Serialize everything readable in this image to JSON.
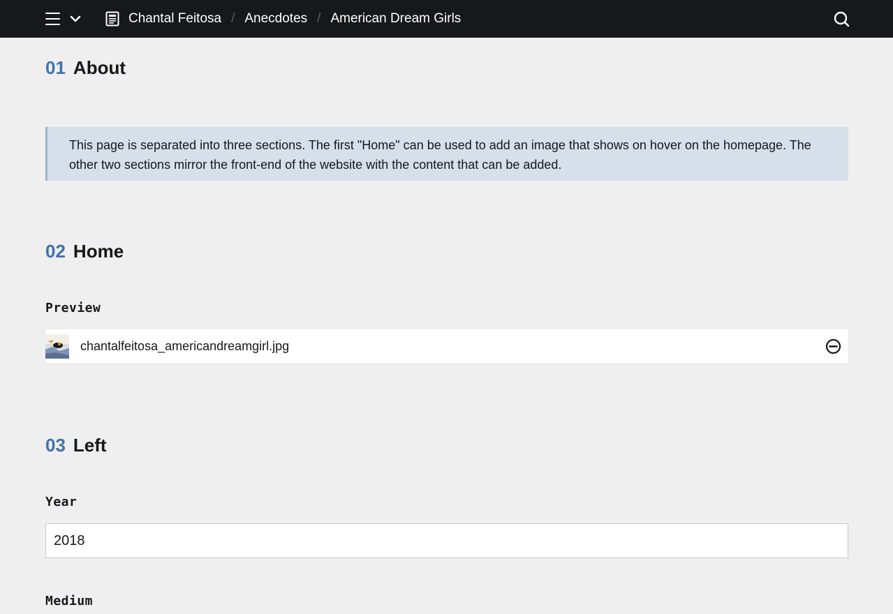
{
  "header": {
    "breadcrumb": [
      {
        "label": "Chantal Feitosa"
      },
      {
        "label": "Anecdotes"
      },
      {
        "label": "American Dream Girls"
      }
    ],
    "separator": "/",
    "icons": {
      "menu": "hamburger-menu-icon",
      "dropdown": "chevron-down-icon",
      "page": "page-document-icon",
      "search": "search-icon"
    }
  },
  "sections": {
    "about": {
      "number": "01",
      "title": "About",
      "info": "This page is separated into three sections. The first \"Home\" can be used to add an image that shows on hover on the homepage. The other two sections mirror the front-end of the website with the content that can be added."
    },
    "home": {
      "number": "02",
      "title": "Home",
      "preview_label": "Preview",
      "file": {
        "name": "chantalfeitosa_americandreamgirl.jpg",
        "remove_icon": "minus-circle-icon"
      }
    },
    "left": {
      "number": "03",
      "title": "Left",
      "year_label": "Year",
      "year_value": "2018",
      "medium_label": "Medium"
    }
  },
  "colors": {
    "topbar_bg": "#17181b",
    "page_bg": "#efefef",
    "accent_number": "#4271ae",
    "info_bg": "#d6e0ea",
    "info_border": "#9fb3c8"
  }
}
